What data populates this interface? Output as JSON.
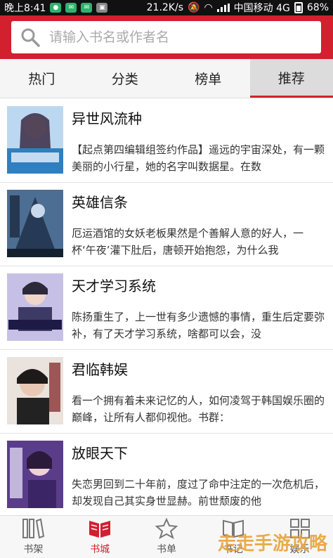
{
  "status_bar": {
    "time": "晚上8:41",
    "speed": "21.2K/s",
    "carrier": "中国移动 4G",
    "battery": "68%"
  },
  "search": {
    "placeholder": "请输入书名或作者名"
  },
  "tabs": [
    {
      "label": "热门",
      "active": false
    },
    {
      "label": "分类",
      "active": false
    },
    {
      "label": "榜单",
      "active": false
    },
    {
      "label": "推荐",
      "active": true
    }
  ],
  "books": [
    {
      "title": "异世风流种",
      "description": "【起点第四编辑组签约作品】遥远的宇宙深处，有一颗美丽的小行星，她的名字叫数据星。在数"
    },
    {
      "title": "英雄信条",
      "description": "厄运酒馆的女妖老板果然是个善解人意的好人，一杯‘午夜’灌下肚后，唐顿开始抱怨，为什么我"
    },
    {
      "title": "天才学习系统",
      "description": "陈扬重生了，上一世有多少遗憾的事情，重生后定要弥补，有了天才学习系统，啥都可以会，没"
    },
    {
      "title": "君临韩娱",
      "description": "看一个拥有着未来记忆的人，如何凌驾于韩国娱乐圈的巅峰，让所有人都仰视他。书群："
    },
    {
      "title": "放眼天下",
      "description": "失恋男回到二十年前，度过了命中注定的一次危机后，却发现自己其实身世显赫。前世颓废的他"
    }
  ],
  "bottom_nav": [
    {
      "label": "书架",
      "icon": "bookshelf-icon",
      "active": false
    },
    {
      "label": "书城",
      "icon": "bookstore-icon",
      "active": true
    },
    {
      "label": "书单",
      "icon": "star-icon",
      "active": false
    },
    {
      "label": "书记",
      "icon": "book-icon",
      "active": false
    },
    {
      "label": "娱乐",
      "icon": "grid-icon",
      "active": false
    }
  ],
  "watermark": "走走手游攻略",
  "colors": {
    "accent": "#d2202f",
    "tab_active_bg": "#dcdcdc"
  }
}
